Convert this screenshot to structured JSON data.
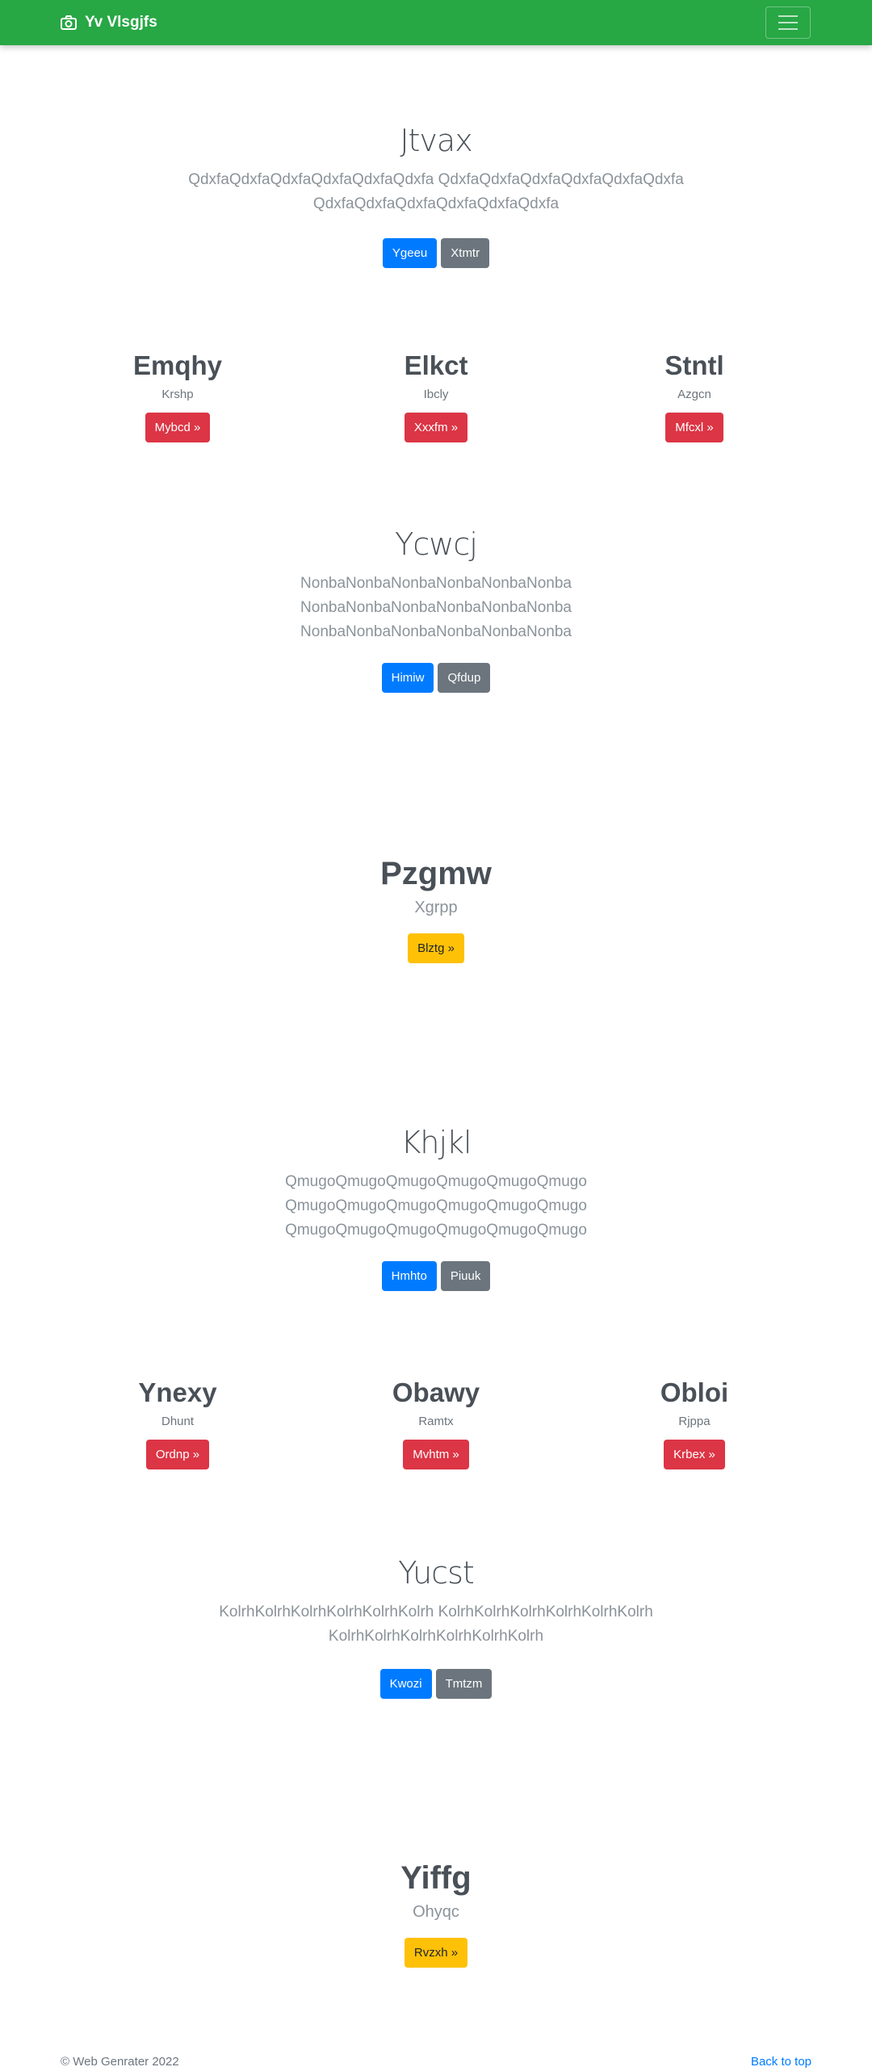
{
  "navbar": {
    "brand": "Yv Vlsgjfs",
    "brand_icon": "camera-icon",
    "bg_color": "#28a745"
  },
  "sections": [
    {
      "title": "Jtvax",
      "text": [
        "QdxfaQdxfaQdxfaQdxfaQdxfaQdxfa QdxfaQdxfaQdxfaQdxfaQdxfaQdxfa",
        "QdxfaQdxfaQdxfaQdxfaQdxfaQdxfa"
      ],
      "primary": "Ygeeu",
      "secondary": "Xtmtr"
    },
    {
      "title": "Ycwcj",
      "text": [
        "NonbaNonbaNonbaNonbaNonbaNonba",
        "NonbaNonbaNonbaNonbaNonbaNonba",
        "NonbaNonbaNonbaNonbaNonbaNonba"
      ],
      "primary": "Himiw",
      "secondary": "Qfdup"
    },
    {
      "title": "Khjkl",
      "text": [
        "QmugoQmugoQmugoQmugoQmugoQmugo",
        "QmugoQmugoQmugoQmugoQmugoQmugo",
        "QmugoQmugoQmugoQmugoQmugoQmugo"
      ],
      "primary": "Hmhto",
      "secondary": "Piuuk"
    },
    {
      "title": "Yucst",
      "text": [
        "KolrhKolrhKolrhKolrhKolrhKolrh KolrhKolrhKolrhKolrhKolrhKolrh",
        "KolrhKolrhKolrhKolrhKolrhKolrh"
      ],
      "primary": "Kwozi",
      "secondary": "Tmtzm"
    }
  ],
  "columns_a": [
    {
      "title": "Emqhy",
      "text": "Krshp",
      "button": "Mybcd »"
    },
    {
      "title": "Elkct",
      "text": "Ibcly",
      "button": "Xxxfm »"
    },
    {
      "title": "Stntl",
      "text": "Azgcn",
      "button": "Mfcxl »"
    }
  ],
  "columns_b": [
    {
      "title": "Ynexy",
      "text": "Dhunt",
      "button": "Ordnp »"
    },
    {
      "title": "Obawy",
      "text": "Ramtx",
      "button": "Mvhtm »"
    },
    {
      "title": "Obloi",
      "text": "Rjppa",
      "button": "Krbex »"
    }
  ],
  "features": [
    {
      "title": "Pzgmw",
      "text": "Xgrpp",
      "button": "Blztg »"
    },
    {
      "title": "Yiffg",
      "text": "Ohyqc",
      "button": "Rvzxh »"
    }
  ],
  "footer": {
    "copyright": "© Web Genrater 2022",
    "back_to_top": "Back to top"
  }
}
